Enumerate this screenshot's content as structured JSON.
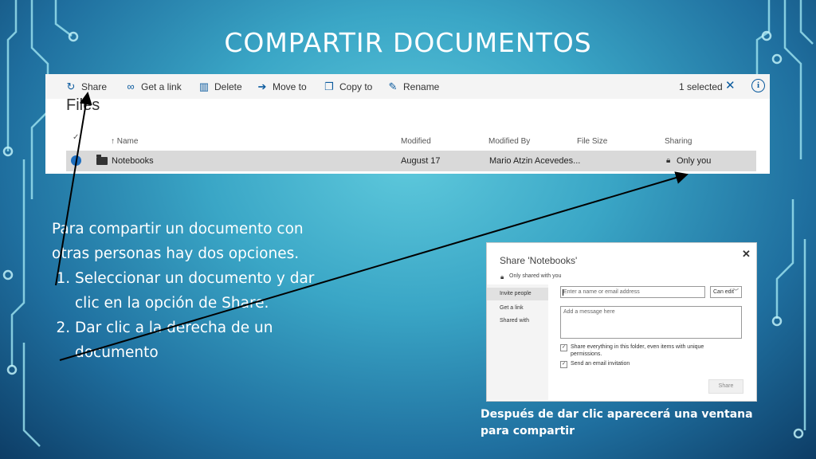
{
  "slide": {
    "title": "COMPARTIR DOCUMENTOS"
  },
  "toolbar": {
    "share": "Share",
    "get_link": "Get a link",
    "delete": "Delete",
    "move_to": "Move to",
    "copy_to": "Copy to",
    "rename": "Rename",
    "selected": "1 selected",
    "close_glyph": "✕",
    "info_glyph": "i"
  },
  "files": {
    "title": "Files",
    "columns": {
      "check": "✓",
      "name": "↑ Name",
      "modified": "Modified",
      "modified_by": "Modified By",
      "file_size": "File Size",
      "sharing": "Sharing"
    },
    "rows": [
      {
        "name": "Notebooks",
        "modified": "August 17",
        "modified_by": "Mario Atzin Acevedes...",
        "file_size": "",
        "sharing": "Only you"
      }
    ]
  },
  "body": {
    "intro": "Para compartir un documento con otras personas hay dos opciones.",
    "steps": [
      "Seleccionar un documento y dar clic en la opción de Share.",
      "Dar clic a la derecha de un documento"
    ]
  },
  "dialog": {
    "title": "Share 'Notebooks'",
    "close_glyph": "✕",
    "subtitle": "Only shared with you",
    "nav": [
      "Invite people",
      "Get a link",
      "Shared with"
    ],
    "name_placeholder": "Enter a name or email address",
    "permission": "Can edit",
    "message_placeholder": "Add a message here",
    "check_share_all": "Share everything in this folder, even items with unique permissions.",
    "check_email": "Send an email invitation",
    "share_button": "Share"
  },
  "caption": "Después de dar clic aparecerá una ventana para compartir",
  "colors": {
    "accent": "#0a5a9e",
    "selected_row": "#d9d9d9",
    "slide_bg": "#3aa6c6"
  },
  "icons": [
    "share-icon",
    "link-icon",
    "trash-icon",
    "move-icon",
    "copy-icon",
    "rename-icon",
    "close-icon",
    "info-icon",
    "folder-icon",
    "lock-icon"
  ]
}
